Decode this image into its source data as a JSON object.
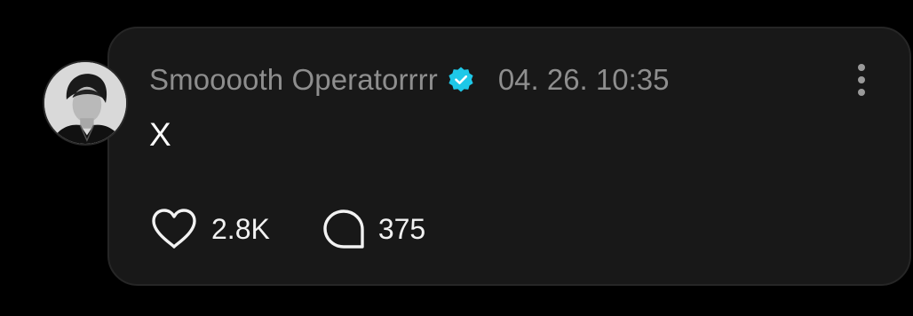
{
  "post": {
    "username": "Smooooth Operatorrrr",
    "verified": true,
    "timestamp": "04. 26. 10:35",
    "text": "X",
    "likes": "2.8K",
    "replies": "375"
  },
  "icons": {
    "verified": "verified-badge-icon",
    "more": "more-vertical-icon",
    "like": "heart-icon",
    "reply": "comment-bubble-icon"
  },
  "colors": {
    "background": "#000000",
    "card": "#181818",
    "muted_text": "#8e8e8e",
    "verified_badge": "#1ec8e8"
  }
}
